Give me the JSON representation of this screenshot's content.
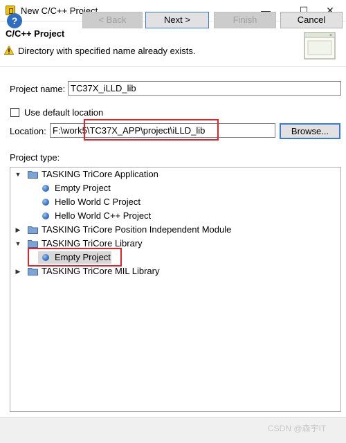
{
  "window": {
    "title": "New C/C++ Project",
    "app_icon": "eclipse-window-icon",
    "minimize_glyph": "—",
    "maximize_glyph": "☐",
    "close_glyph": "✕"
  },
  "header": {
    "title": "C/C++ Project",
    "message": "Directory with specified name already exists.",
    "message_icon": "warning-icon",
    "banner_icon": "wizard-banner-icon"
  },
  "form": {
    "project_name_label": "Project name:",
    "project_name_value": "TC37X_iLLD_lib",
    "use_default_location_label": "Use default location",
    "use_default_location_checked": false,
    "location_label": "Location:",
    "location_value": "F:\\work5\\TC37X_APP\\project\\iLLD_lib",
    "browse_label": "Browse..."
  },
  "project_type": {
    "label": "Project type:",
    "items": [
      {
        "label": "TASKING TriCore Application",
        "kind": "folder",
        "expanded": true,
        "level": 0
      },
      {
        "label": "Empty Project",
        "kind": "template",
        "level": 1
      },
      {
        "label": "Hello World C Project",
        "kind": "template",
        "level": 1
      },
      {
        "label": "Hello World C++ Project",
        "kind": "template",
        "level": 1
      },
      {
        "label": "TASKING TriCore Position Independent Module",
        "kind": "folder",
        "expanded": false,
        "level": 0
      },
      {
        "label": "TASKING TriCore Library",
        "kind": "folder",
        "expanded": true,
        "level": 0
      },
      {
        "label": "Empty Project",
        "kind": "template",
        "level": 1,
        "selected": true
      },
      {
        "label": "TASKING TriCore MIL Library",
        "kind": "folder",
        "expanded": false,
        "level": 0
      }
    ]
  },
  "footer": {
    "help_glyph": "?",
    "back_label": "< Back",
    "next_label": "Next >",
    "finish_label": "Finish",
    "cancel_label": "Cancel"
  },
  "watermark": "CSDN @森宇IT",
  "colors": {
    "highlight_box": "#e8202a",
    "selection": "#d8d8d8",
    "focus_border": "#3b7bd6"
  }
}
